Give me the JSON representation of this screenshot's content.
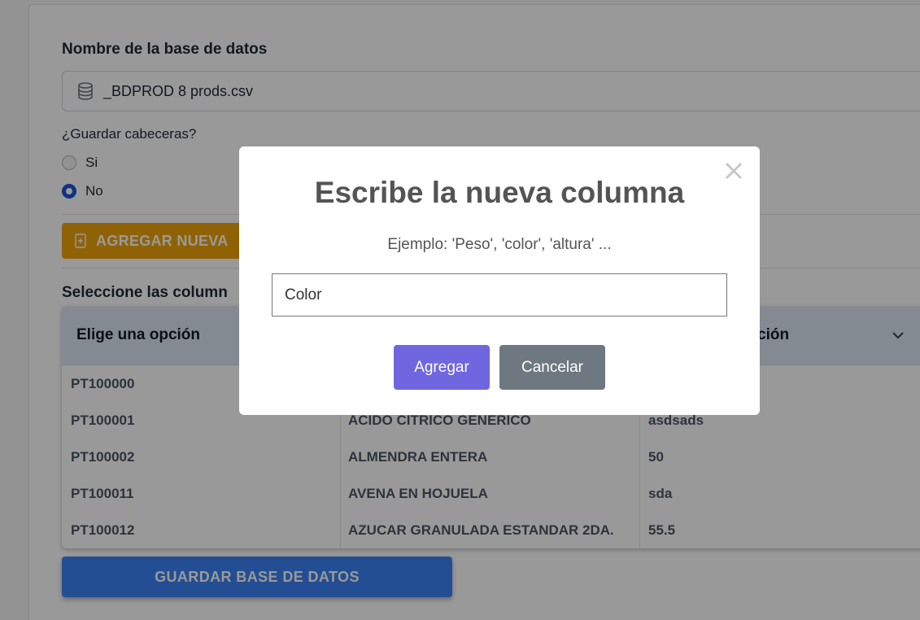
{
  "form": {
    "db_name_label": "Nombre de la base de datos",
    "db_name_value": "_BDPROD 8 prods.csv",
    "headers_question": "¿Guardar cabeceras?",
    "radio_options": [
      "Si",
      "No"
    ],
    "radio_selected": "No",
    "add_button_label": "AGREGAR NUEVA",
    "select_columns_label": "Seleccione las column",
    "save_button_label": "GUARDAR BASE DE DATOS"
  },
  "table": {
    "headers": [
      "Elige una opción",
      "",
      "ción"
    ],
    "rows": [
      [
        "PT100000",
        "",
        ""
      ],
      [
        "PT100001",
        "ACIDO CITRICO GENERICO",
        "asdsads"
      ],
      [
        "PT100002",
        "ALMENDRA ENTERA",
        "50"
      ],
      [
        "PT100011",
        "AVENA EN HOJUELA",
        "sda"
      ],
      [
        "PT100012",
        "AZUCAR GRANULADA ESTANDAR 2DA.",
        "55.5"
      ]
    ]
  },
  "modal": {
    "title": "Escribe la nueva columna",
    "text": "Ejemplo: 'Peso', 'color', 'altura' ...",
    "input_value": "Color",
    "confirm_label": "Agregar",
    "cancel_label": "Cancelar"
  },
  "colors": {
    "add_button": "#f0a30a",
    "save_button": "#3b82f6",
    "confirm_button": "#7066e0",
    "cancel_button": "#6e7881",
    "radio_selected": "#1a56db"
  },
  "icons": {
    "db_input": "database-icon",
    "add_button": "file-plus-icon",
    "table_header": "chevron-down-icon",
    "modal_close": "close-icon"
  }
}
